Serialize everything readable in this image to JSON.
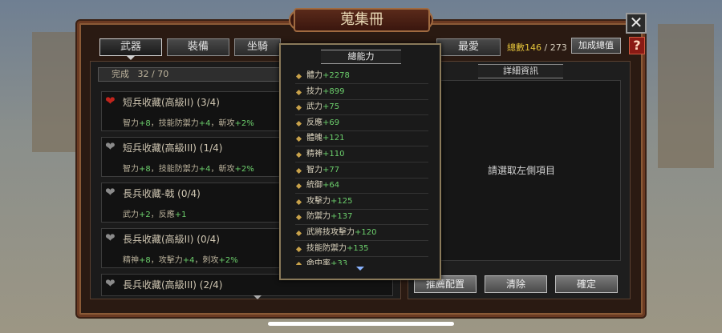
{
  "window": {
    "title": "蒐集冊"
  },
  "tabs": [
    {
      "label": "武器"
    },
    {
      "label": "裝備"
    },
    {
      "label": "坐騎"
    },
    {
      "label": "最愛"
    }
  ],
  "header": {
    "total_label": "總數",
    "total_value": "146",
    "total_max": "/ 273",
    "add_button": "加成總值",
    "help_label": "?",
    "close_label": "✕"
  },
  "progress": {
    "label": "完成",
    "value": "32 / 70"
  },
  "collections": [
    {
      "name": "短兵收藏(高級II) (3/4)",
      "favorite": true,
      "effect": [
        {
          "k": "智力",
          "v": "+8"
        },
        {
          "k": "，技能防禦力",
          "v": "+4"
        },
        {
          "k": "，斬攻",
          "v": "+2%"
        }
      ]
    },
    {
      "name": "短兵收藏(高級III) (1/4)",
      "favorite": false,
      "effect": [
        {
          "k": "智力",
          "v": "+8"
        },
        {
          "k": "，技能防禦力",
          "v": "+4"
        },
        {
          "k": "，斬攻",
          "v": "+2%"
        }
      ]
    },
    {
      "name": "長兵收藏-戟 (0/4)",
      "favorite": false,
      "effect": [
        {
          "k": "武力",
          "v": "+2"
        },
        {
          "k": "，反應",
          "v": "+1"
        }
      ]
    },
    {
      "name": "長兵收藏(高級II) (0/4)",
      "favorite": false,
      "effect": [
        {
          "k": "精神",
          "v": "+8"
        },
        {
          "k": "，攻擊力",
          "v": "+4"
        },
        {
          "k": "，刺攻",
          "v": "+2%"
        }
      ]
    },
    {
      "name": "長兵收藏(高級III) (2/4)",
      "favorite": false,
      "effect": []
    }
  ],
  "stats_popup": {
    "title": "總能力",
    "stats": [
      {
        "label": "體力",
        "value": "+2278"
      },
      {
        "label": "技力",
        "value": "+899"
      },
      {
        "label": "武力",
        "value": "+75"
      },
      {
        "label": "反應",
        "value": "+69"
      },
      {
        "label": "體魄",
        "value": "+121"
      },
      {
        "label": "精神",
        "value": "+110"
      },
      {
        "label": "智力",
        "value": "+77"
      },
      {
        "label": "統御",
        "value": "+64"
      },
      {
        "label": "攻擊力",
        "value": "+125"
      },
      {
        "label": "防禦力",
        "value": "+137"
      },
      {
        "label": "武將技攻擊力",
        "value": "+120"
      },
      {
        "label": "技能防禦力",
        "value": "+135"
      },
      {
        "label": "命中率",
        "value": "+33"
      }
    ]
  },
  "detail": {
    "title": "詳細資訊",
    "hint": "請選取左側項目"
  },
  "buttons": {
    "recommend": "推薦配置",
    "clear": "清除",
    "confirm": "確定"
  },
  "colors": {
    "accent_gold": "#e2c23a",
    "bonus_green": "#6ccf6c",
    "favorite_red": "#c0241c"
  }
}
